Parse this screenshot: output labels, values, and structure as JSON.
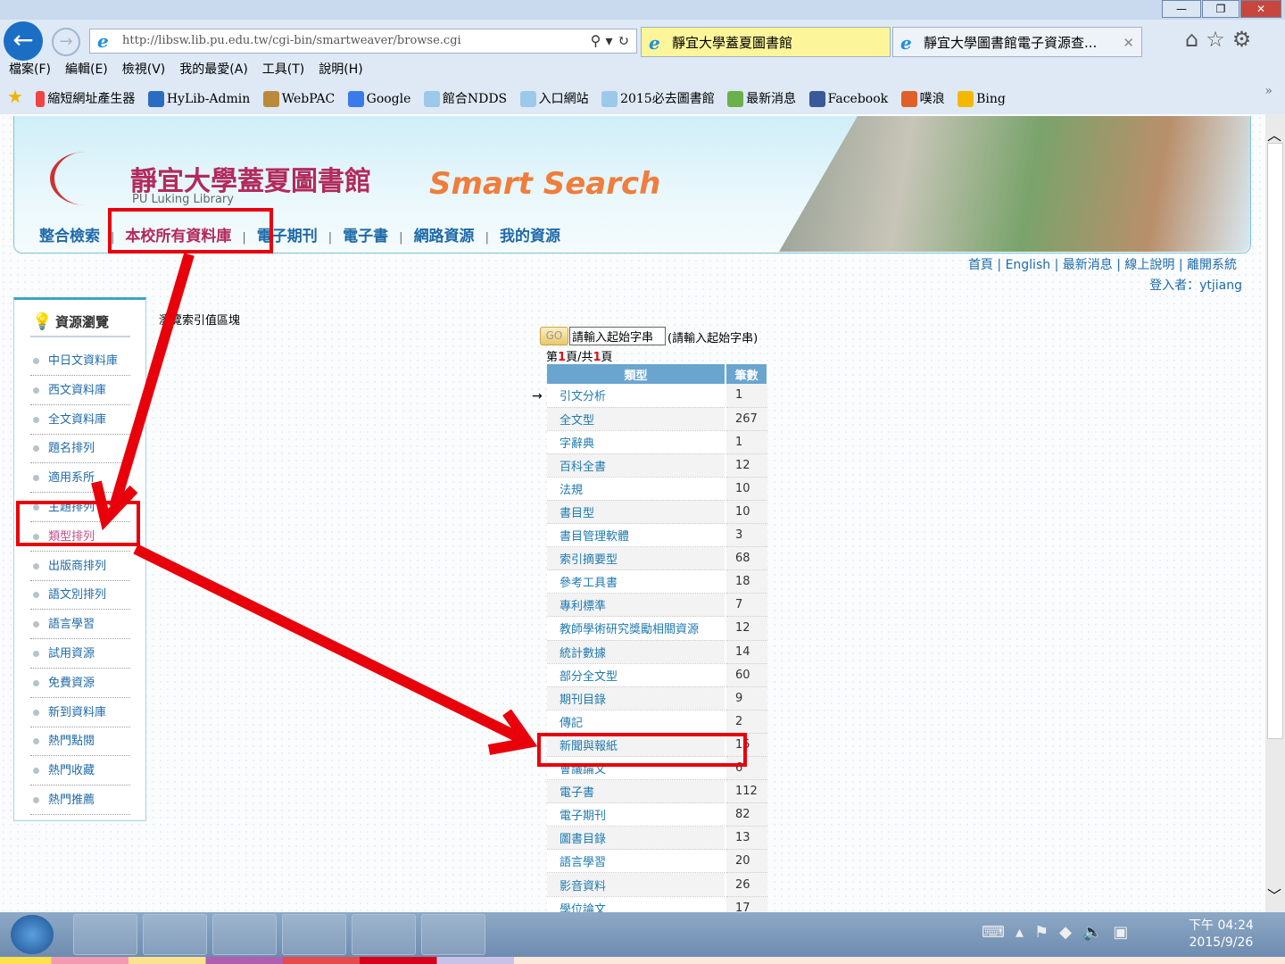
{
  "browser": {
    "url": "http://libsw.lib.pu.edu.tw/cgi-bin/smartweaver/browse.cgi",
    "tabs": [
      {
        "label": "靜宜大學蓋夏圖書館"
      },
      {
        "label": "靜宜大學圖書館電子資源查..."
      }
    ],
    "menu": [
      "檔案(F)",
      "編輯(E)",
      "檢視(V)",
      "我的最愛(A)",
      "工具(T)",
      "說明(H)"
    ],
    "favorites": [
      "縮短網址產生器",
      "HyLib-Admin",
      "WebPAC",
      "Google",
      "館合NDDS",
      "入口網站",
      "2015必去圖書館",
      "最新消息",
      "Facebook",
      "噗浪",
      "Bing"
    ],
    "more": "»"
  },
  "banner": {
    "logo_zh": "靜宜大學蓋夏圖書館",
    "logo_en": "PU Luking Library",
    "product": "Smart Search",
    "nav": [
      "整合檢索",
      "本校所有資料庫",
      "電子期刊",
      "電子書",
      "網路資源",
      "我的資源"
    ]
  },
  "toplinks": [
    "首頁",
    "English",
    "最新消息",
    "線上說明",
    "離開系統"
  ],
  "user": "登入者：ytjiang",
  "sidebar": {
    "title": "資源瀏覽",
    "items": [
      "中日文資料庫",
      "西文資料庫",
      "全文資料庫",
      "題名排列",
      "適用系所",
      "主題排列",
      "類型排列",
      "出版商排列",
      "語文別排列",
      "語言學習",
      "試用資源",
      "免費資源",
      "新到資料庫",
      "熱門點閱",
      "熱門收藏",
      "熱門推薦"
    ],
    "active": "類型排列"
  },
  "main": {
    "block_label": "瀏覽索引值區塊",
    "go": "GO",
    "start_value": "請輸入起始字串",
    "hint": "(請輸入起始字串)",
    "pager": {
      "prefix": "第",
      "page": "1",
      "mid": "頁/共",
      "total": "1",
      "suffix": "頁"
    },
    "row_marker": "→",
    "columns": [
      "類型",
      "筆數"
    ],
    "rows": [
      [
        "引文分析",
        "1"
      ],
      [
        "全文型",
        "267"
      ],
      [
        "字辭典",
        "1"
      ],
      [
        "百科全書",
        "12"
      ],
      [
        "法規",
        "10"
      ],
      [
        "書目型",
        "10"
      ],
      [
        "書目管理軟體",
        "3"
      ],
      [
        "索引摘要型",
        "68"
      ],
      [
        "參考工具書",
        "18"
      ],
      [
        "專利標準",
        "7"
      ],
      [
        "教師學術研究獎勵相關資源",
        "12"
      ],
      [
        "統計數據",
        "14"
      ],
      [
        "部分全文型",
        "60"
      ],
      [
        "期刊目錄",
        "9"
      ],
      [
        "傳記",
        "2"
      ],
      [
        "新聞與報紙",
        "15"
      ],
      [
        "會議論文",
        "6"
      ],
      [
        "電子書",
        "112"
      ],
      [
        "電子期刊",
        "82"
      ],
      [
        "圖書目錄",
        "13"
      ],
      [
        "語言學習",
        "20"
      ],
      [
        "影音資料",
        "26"
      ],
      [
        "學位論文",
        "17"
      ]
    ]
  },
  "taskbar": {
    "time": "下午 04:24",
    "date": "2015/9/26"
  },
  "colors": {
    "annotation": "#e8000b",
    "link": "#1f6aa8",
    "header": "#6aa5d0"
  }
}
